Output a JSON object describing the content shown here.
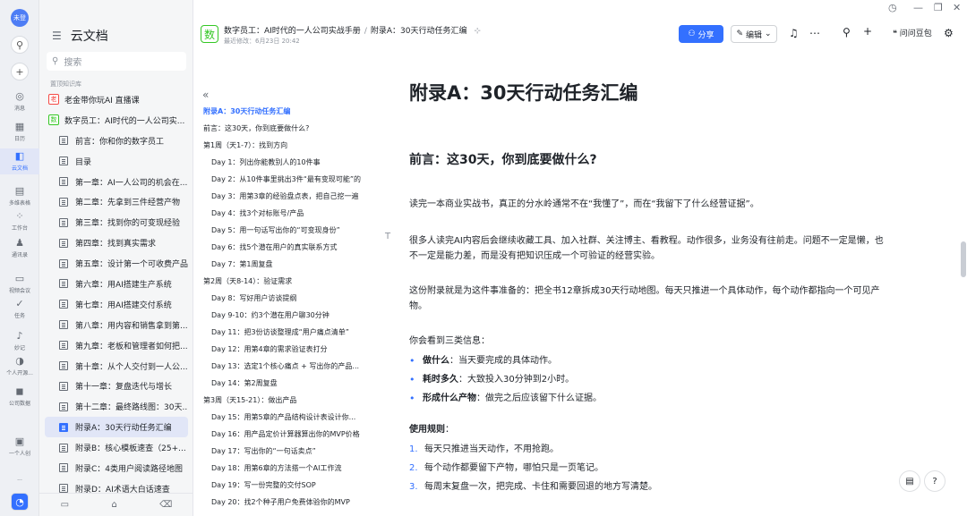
{
  "rail": {
    "avatar": "未登",
    "items": [
      {
        "label": "消息",
        "icon": "message-icon",
        "glyph": "◎"
      },
      {
        "label": "日历",
        "icon": "calendar-icon",
        "glyph": "▦"
      },
      {
        "label": "云文档",
        "icon": "cloud-doc-icon",
        "glyph": "◧",
        "active": true
      },
      {
        "label": "多维表格",
        "icon": "base-icon",
        "glyph": "▤"
      },
      {
        "label": "工作台",
        "icon": "workplace-icon",
        "glyph": "⁘"
      },
      {
        "label": "通讯录",
        "icon": "contacts-icon",
        "glyph": "♟"
      },
      {
        "label": "视频会议",
        "icon": "video-icon",
        "glyph": "▭"
      },
      {
        "label": "任务",
        "icon": "task-icon",
        "glyph": "✓"
      },
      {
        "label": "妙记",
        "icon": "minutes-icon",
        "glyph": "♪"
      },
      {
        "label": "个人开源...",
        "icon": "open-source-icon",
        "glyph": "◑"
      },
      {
        "label": "公司数据",
        "icon": "company-data-icon",
        "glyph": "◼"
      },
      {
        "label": "一个人创",
        "icon": "solo-icon",
        "glyph": "▣"
      }
    ]
  },
  "sidebar": {
    "title": "云文档",
    "search_placeholder": "搜索",
    "section": "置顶知识库",
    "items": [
      {
        "label": "老金带你玩AI 直播课",
        "level": 0,
        "badge": "老",
        "badge_color": "red"
      },
      {
        "label": "数字员工：AI时代的一人公司实...",
        "level": 0,
        "badge": "数",
        "badge_color": "green"
      },
      {
        "label": "前言：你和你的数字员工",
        "level": 1
      },
      {
        "label": "目录",
        "level": 1
      },
      {
        "label": "第一章：AI一人公司的机会在...",
        "level": 1
      },
      {
        "label": "第二章：先拿到三件经营产物",
        "level": 1
      },
      {
        "label": "第三章：找到你的可变现经验",
        "level": 1
      },
      {
        "label": "第四章：找到真实需求",
        "level": 1
      },
      {
        "label": "第五章：设计第一个可收费产品",
        "level": 1
      },
      {
        "label": "第六章：用AI搭建生产系统",
        "level": 1
      },
      {
        "label": "第七章：用AI搭建交付系统",
        "level": 1
      },
      {
        "label": "第八章：用内容和销售拿到第...",
        "level": 1
      },
      {
        "label": "第九章：老板和管理者如何把...",
        "level": 1
      },
      {
        "label": "第十章：从个人交付到一人公...",
        "level": 1
      },
      {
        "label": "第十一章：复盘迭代与增长",
        "level": 1
      },
      {
        "label": "第十二章：最终路线图：30天...",
        "level": 1
      },
      {
        "label": "附录A：30天行动任务汇编",
        "level": 1,
        "selected": true
      },
      {
        "label": "附录B：核心模板速查（25+...",
        "level": 1
      },
      {
        "label": "附录C：4类用户阅读路径地图",
        "level": 1
      },
      {
        "label": "附录D：AI术语大白话速查",
        "level": 1
      }
    ]
  },
  "topbar": {
    "breadcrumb_1": "数字员工：AI时代的一人公司实战手册",
    "breadcrumb_2": "附录A：30天行动任务汇编",
    "meta": "最近修改：6月23日 20:42",
    "badge": "数",
    "share": "分享",
    "edit": "编辑",
    "ai": "问问豆包"
  },
  "outline": {
    "items": [
      {
        "text": "附录A：30天行动任务汇编",
        "level": 0,
        "active": true
      },
      {
        "text": "前言：这30天，你到底要做什么?",
        "level": 0
      },
      {
        "text": "第1周（天1-7）：找到方向",
        "level": 0
      },
      {
        "text": "Day 1：列出你能教别人的10件事",
        "level": 1
      },
      {
        "text": "Day 2：从10件事里挑出3件“最有变现可能”的",
        "level": 1
      },
      {
        "text": "Day 3：用第3章的经验盘点表，把自己挖一遍",
        "level": 1
      },
      {
        "text": "Day 4：找3个对标账号/产品",
        "level": 1
      },
      {
        "text": "Day 5：用一句话写出你的“可变现身份”",
        "level": 1
      },
      {
        "text": "Day 6：找5个潜在用户的真实联系方式",
        "level": 1
      },
      {
        "text": "Day 7：第1周复盘",
        "level": 1
      },
      {
        "text": "第2周（天8-14）：验证需求",
        "level": 0
      },
      {
        "text": "Day 8：写好用户访谈提纲",
        "level": 1
      },
      {
        "text": "Day 9-10：约3个潜在用户聊30分钟",
        "level": 1
      },
      {
        "text": "Day 11：把3份访谈整理成“用户痛点清单”",
        "level": 1
      },
      {
        "text": "Day 12：用第4章的需求验证表打分",
        "level": 1
      },
      {
        "text": "Day 13：选定1个核心痛点 + 写出你的产品...",
        "level": 1
      },
      {
        "text": "Day 14：第2周复盘",
        "level": 1
      },
      {
        "text": "第3周（天15-21）：做出产品",
        "level": 0
      },
      {
        "text": "Day 15：用第5章的产品结构设计表设计你...",
        "level": 1
      },
      {
        "text": "Day 16：用产品定价计算器算出你的MVP价格",
        "level": 1
      },
      {
        "text": "Day 17：写出你的“一句话卖点”",
        "level": 1
      },
      {
        "text": "Day 18：用第6章的方法搭一个AI工作流",
        "level": 1
      },
      {
        "text": "Day 19：写一份完整的交付SOP",
        "level": 1
      },
      {
        "text": "Day 20：找2个种子用户免费体验你的MVP",
        "level": 1
      }
    ]
  },
  "content": {
    "title": "附录A：30天行动任务汇编",
    "h2": "前言：这30天，你到底要做什么?",
    "p1": "读完一本商业实战书，真正的分水岭通常不在“我懂了”，而在“我留下了什么经营证据”。",
    "p2": "很多人读完AI内容后会继续收藏工具、加入社群、关注博主、看教程。动作很多，业务没有往前走。问题不一定是懒，也不一定是能力差，而是没有把知识压成一个可验证的经营实验。",
    "p3": "这份附录就是为这件事准备的：把全书12章拆成30天行动地图。每天只推进一个具体动作，每个动作都指向一个可见产物。",
    "p4": "你会看到三类信息：",
    "bullets": [
      {
        "bold": "做什么",
        "rest": "：当天要完成的具体动作。"
      },
      {
        "bold": "耗时多久",
        "rest": "：大致投入30分钟到2小时。"
      },
      {
        "bold": "形成什么产物",
        "rest": "：做完之后应该留下什么证据。"
      }
    ],
    "rules_label": "使用规则",
    "rules_colon": "：",
    "rules": [
      {
        "n": "1.",
        "text": "每天只推进当天动作，不用抢跑。"
      },
      {
        "n": "2.",
        "text": "每个动作都要留下产物，哪怕只是一页笔记。"
      },
      {
        "n": "3.",
        "text": "每周末复盘一次，把完成、卡住和需要回退的地方写清楚。"
      }
    ]
  }
}
